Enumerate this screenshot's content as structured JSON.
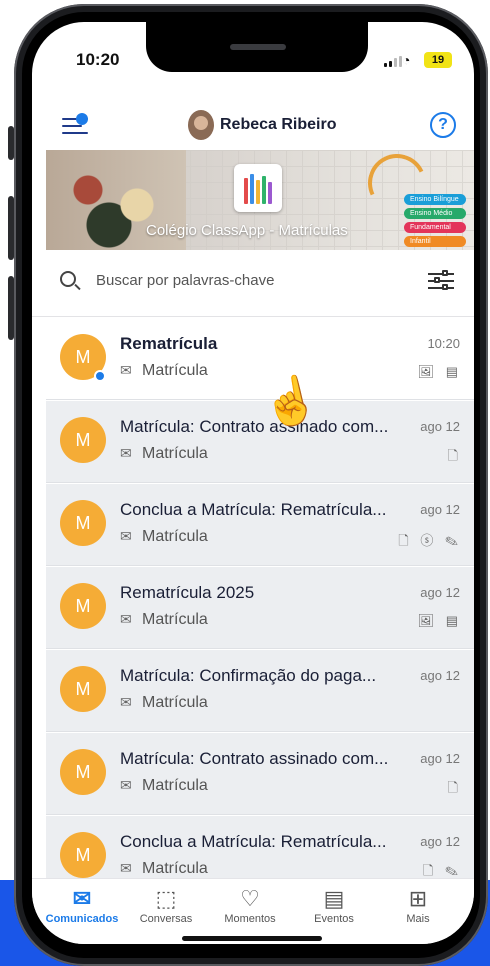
{
  "status_bar": {
    "time": "10:20",
    "battery": "19"
  },
  "header": {
    "user_name": "Rebeca Ribeiro",
    "help_label": "?"
  },
  "banner": {
    "title": "Colégio ClassApp - Matrículas",
    "tags": [
      {
        "label": "Ensino Bilíngue",
        "color": "#1a9ed8"
      },
      {
        "label": "Ensino Médio",
        "color": "#27a96a"
      },
      {
        "label": "Fundamental",
        "color": "#e3345a"
      },
      {
        "label": "Infantil",
        "color": "#f08a24"
      }
    ]
  },
  "search": {
    "placeholder": "Buscar por palavras-chave"
  },
  "messages": [
    {
      "avatar": "M",
      "title": "Rematrícula",
      "category": "Matrícula",
      "time": "10:20",
      "icons": "🖼 ▤",
      "unread": true
    },
    {
      "avatar": "M",
      "title": "Matrícula: Contrato assinado com...",
      "category": "Matrícula",
      "time": "ago 12",
      "icons": "🗋",
      "unread": false
    },
    {
      "avatar": "M",
      "title": "Conclua a Matrícula: Rematrícula...",
      "category": "Matrícula",
      "time": "ago 12",
      "icons": "🗋 ⓢ ✎",
      "unread": false
    },
    {
      "avatar": "M",
      "title": "Rematrícula 2025",
      "category": "Matrícula",
      "time": "ago 12",
      "icons": "🖼 ▤",
      "unread": false
    },
    {
      "avatar": "M",
      "title": "Matrícula: Confirmação do paga...",
      "category": "Matrícula",
      "time": "ago 12",
      "icons": "",
      "unread": false
    },
    {
      "avatar": "M",
      "title": "Matrícula: Contrato assinado com...",
      "category": "Matrícula",
      "time": "ago 12",
      "icons": "🗋",
      "unread": false
    },
    {
      "avatar": "M",
      "title": "Conclua a Matrícula: Rematrícula...",
      "category": "Matrícula",
      "time": "ago 12",
      "icons": "🗋 ✎",
      "unread": false
    }
  ],
  "tabs": [
    {
      "label": "Comunicados",
      "icon": "envelope-icon",
      "active": true
    },
    {
      "label": "Conversas",
      "icon": "chat-icon",
      "active": false
    },
    {
      "label": "Momentos",
      "icon": "heart-icon",
      "active": false
    },
    {
      "label": "Eventos",
      "icon": "calendar-icon",
      "active": false
    },
    {
      "label": "Mais",
      "icon": "grid-plus-icon",
      "active": false
    }
  ],
  "colors": {
    "accent": "#1c7be8",
    "avatar": "#f5ac36",
    "background_band": "#1a56e8"
  }
}
